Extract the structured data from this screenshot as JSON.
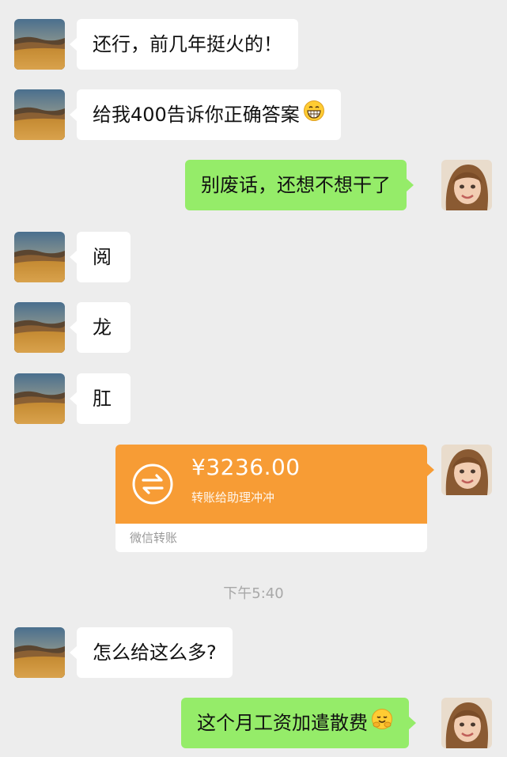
{
  "messages": [
    {
      "side": "in",
      "text": "还行，前几年挺火的！"
    },
    {
      "side": "in",
      "text": "给我400告诉你正确答案",
      "emoji": "grin-emoji"
    },
    {
      "side": "out",
      "text": "别废话，还想不想干了"
    },
    {
      "side": "in",
      "text": "阅"
    },
    {
      "side": "in",
      "text": "龙"
    },
    {
      "side": "in",
      "text": "肛"
    },
    {
      "side": "out",
      "type": "transfer"
    },
    {
      "side": "in",
      "text": "怎么给这么多?"
    },
    {
      "side": "out",
      "text": "这个月工资加遣散费",
      "emoji": "hug-emoji"
    }
  ],
  "transfer": {
    "amount": "¥3236.00",
    "note": "转账给助理冲冲",
    "footer": "微信转账",
    "color": "#f79c35"
  },
  "timestamp": "下午5:40",
  "colors": {
    "background": "#ededed",
    "incoming_bubble": "#ffffff",
    "outgoing_bubble": "#95ec69"
  },
  "avatars": {
    "contact": "desert-landscape-avatar",
    "me": "girl-portrait-avatar"
  }
}
